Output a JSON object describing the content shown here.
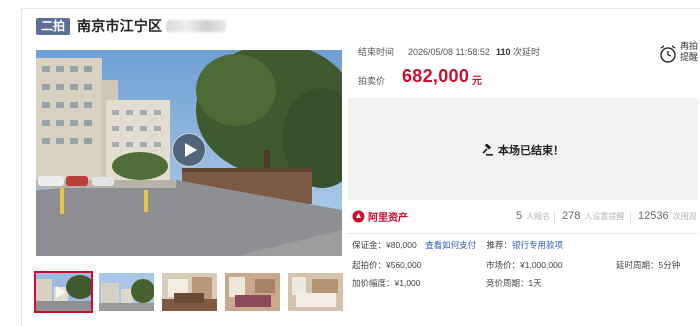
{
  "header": {
    "badge": "二拍",
    "title": "南京市江宁区"
  },
  "gallery": {
    "thumbs": [
      "thumb-1",
      "thumb-2",
      "thumb-3",
      "thumb-4",
      "thumb-5"
    ],
    "play_icon": "play-icon"
  },
  "auction": {
    "end_time_label": "结束时间",
    "end_time": "2026/05/08 11:58:52",
    "delay_count": "110",
    "delay_suffix": "次延时",
    "remind_label": "再拍\n提醒",
    "price_label": "拍卖价",
    "price": "682,000",
    "price_unit": "元",
    "ended_text": "本场已结束！"
  },
  "stats": {
    "brand": "阿里资产",
    "signups": "5",
    "signups_label": "人报名",
    "reminders": "278",
    "reminders_label": "人设置提醒",
    "views": "12536",
    "views_label": "次围观"
  },
  "details": {
    "deposit_label": "保证金：",
    "deposit": "¥80,000",
    "pay_link": "查看如何支付",
    "recommend_label": "推荐：",
    "loan_link": "银行专用款项",
    "start_price": "起拍价：¥560,000",
    "market_price": "市场价：¥1,000,000",
    "delay_period": "延时周期：5分钟",
    "increment": "加价幅度：¥1,000",
    "bid_period": "竞价周期：1天"
  },
  "colors": {
    "accent": "#c8102e",
    "badge": "#5b6f98",
    "link": "#2f5fb3"
  }
}
